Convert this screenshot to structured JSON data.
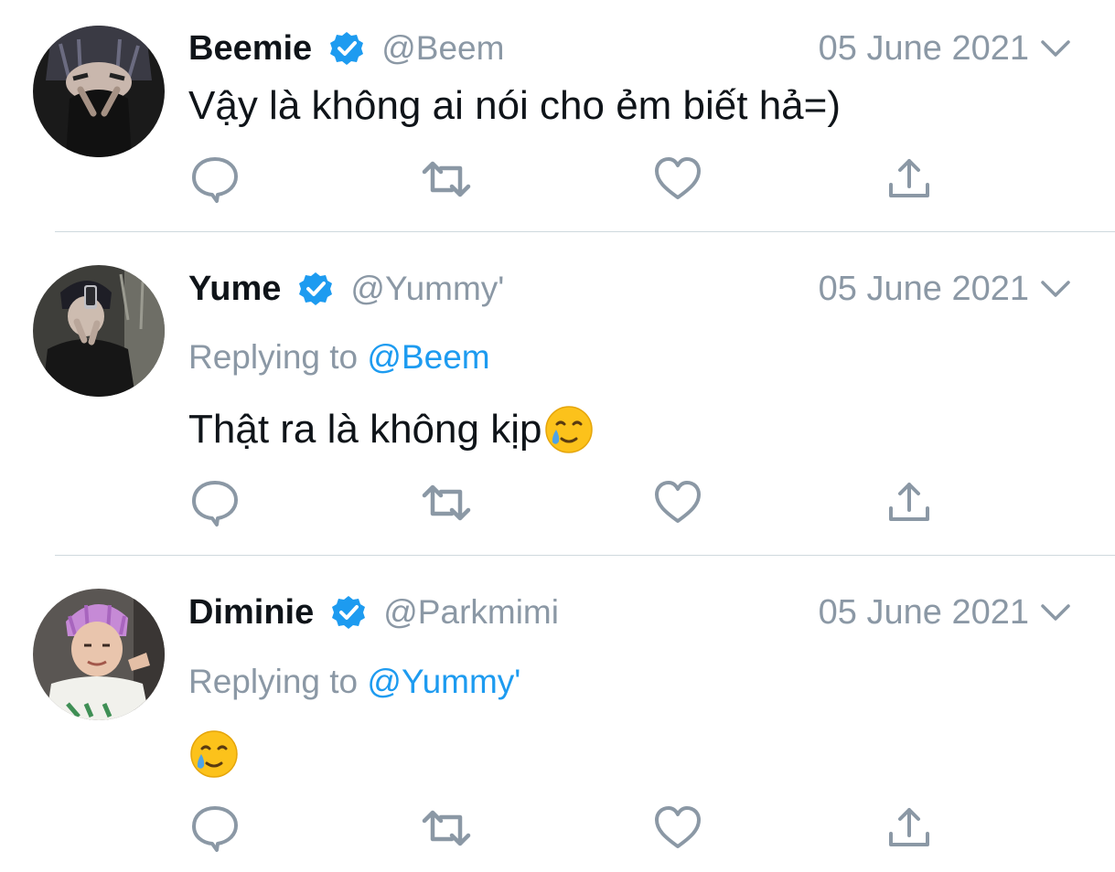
{
  "tweets": [
    {
      "name": "Beemie",
      "handle": "@Beem",
      "date": "05 June 2021",
      "replying_prefix": "",
      "replying_to": "",
      "text": "Vậy là không ai nói cho ẻm biết hả=)",
      "emoji": ""
    },
    {
      "name": "Yume",
      "handle": "@Yummy'",
      "date": "05 June 2021",
      "replying_prefix": "Replying to ",
      "replying_to": "@Beem",
      "text": "Thật ra là không kịp",
      "emoji": "smiling-face-with-tear"
    },
    {
      "name": "Diminie",
      "handle": "@Parkmimi",
      "date": "05 June 2021",
      "replying_prefix": "Replying to ",
      "replying_to": "@Yummy'",
      "text": "",
      "emoji": "smiling-face-with-tear"
    }
  ],
  "icons": {
    "verified": "verified-badge-icon",
    "menu": "chevron-down-icon",
    "reply": "reply-icon",
    "retweet": "retweet-icon",
    "like": "heart-icon",
    "share": "share-icon"
  },
  "colors": {
    "verified": "#1d9bf0",
    "mention": "#1d9bf0",
    "secondary_text": "#8b98a5",
    "icon": "#8b98a5",
    "divider": "#cfd9de"
  }
}
